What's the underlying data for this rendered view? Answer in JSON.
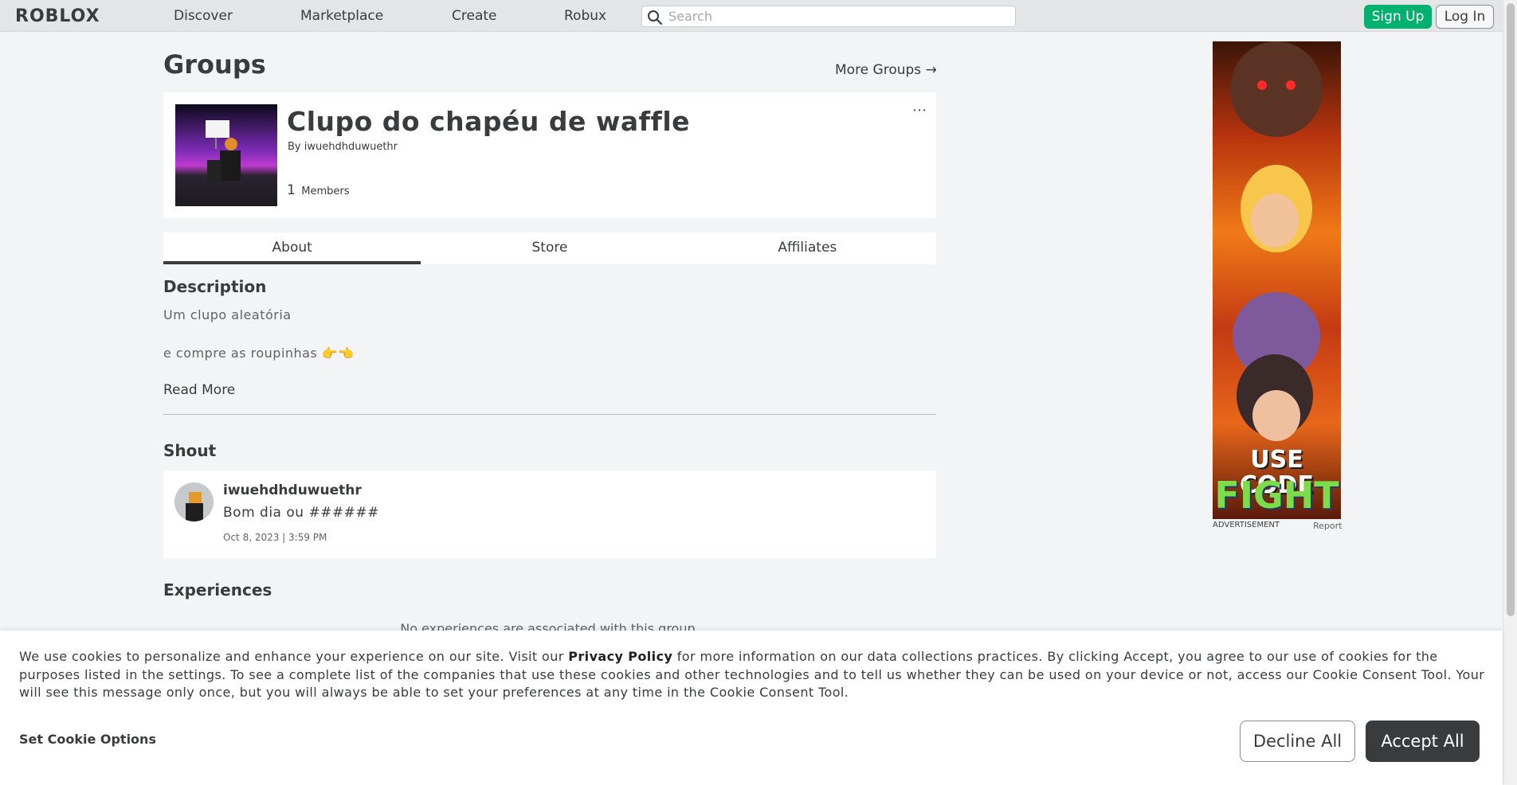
{
  "header": {
    "logo": "ROBLOX",
    "nav": [
      "Discover",
      "Marketplace",
      "Create",
      "Robux"
    ],
    "search_placeholder": "Search",
    "signup_label": "Sign Up",
    "login_label": "Log In"
  },
  "page": {
    "title": "Groups",
    "more_groups": "More Groups →"
  },
  "group": {
    "name": "Clupo do chapéu de waffle",
    "owner": "By iwuehdhduwuethr",
    "member_count": "1",
    "member_label": "Members",
    "more_icon": "⋯"
  },
  "tabs": [
    "About",
    "Store",
    "Affiliates"
  ],
  "about": {
    "description_title": "Description",
    "description_lines": [
      "Um clupo aleatória",
      "e compre as roupinhas 👉👈"
    ],
    "read_more": "Read More"
  },
  "shout": {
    "title": "Shout",
    "user": "iwuehdhduwuethr",
    "text": "Bom dia ou ######",
    "date": "Oct 8, 2023 | 3:59 PM"
  },
  "experiences": {
    "title": "Experiences",
    "empty_text": "No experiences are associated with this group."
  },
  "ad": {
    "line1": "USE CODE",
    "line2": "FIGHT",
    "label": "ADVERTISEMENT",
    "report": "Report"
  },
  "cookie": {
    "text_before_link": "We use cookies to personalize and enhance your experience on our site. Visit our ",
    "link": "Privacy Policy",
    "text_after_link": " for more information on our data collections practices. By clicking Accept, you agree to our use of cookies for the purposes listed in the settings. To see a complete list of the companies that use these cookies and other technologies and to tell us whether they can be used on your device or not, access our Cookie Consent Tool. Your will see this message only once, but you will always be able to set your preferences at any time in the Cookie Consent Tool.",
    "set_options": "Set Cookie Options",
    "decline": "Decline All",
    "accept": "Accept All"
  },
  "colors": {
    "signup_green": "#00b06f",
    "text_dark": "#393b3d",
    "page_bg": "#f2f4f5"
  },
  "icons": [
    "search-icon",
    "arrow-right-icon",
    "more-options-icon"
  ]
}
